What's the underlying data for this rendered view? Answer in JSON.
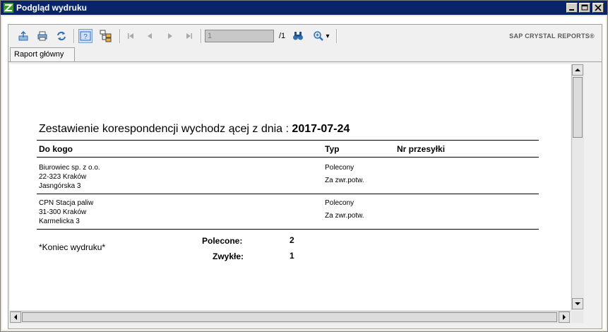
{
  "window": {
    "title": "Podgląd wydruku",
    "min_glyph": "0",
    "max_glyph": "1",
    "close_glyph": "r"
  },
  "toolbar": {
    "page_value": "1",
    "page_total": "/1",
    "brand": "SAP CRYSTAL REPORTS®",
    "zoom_caret": "▾"
  },
  "tabs": [
    {
      "label": "Raport główny"
    }
  ],
  "report": {
    "heading": "Zestawienie korespondencji wychodz ącej z dnia :",
    "date": "2017-07-24",
    "columns": {
      "to": "Do kogo",
      "type": "Typ",
      "tracking": "Nr przesyłki"
    },
    "rows": [
      {
        "address": [
          "Biurowiec sp. z o.o.",
          "22-323 Kraków",
          "Jasngórska 3"
        ],
        "type": [
          "Polecony",
          "Za zwr.potw."
        ],
        "tracking": ""
      },
      {
        "address": [
          "CPN Stacja paliw",
          "31-300 Kraków",
          "Karmelicka 3"
        ],
        "type": [
          "Polecony",
          "Za zwr.potw."
        ],
        "tracking": ""
      }
    ],
    "footer": {
      "end_label": "*Koniec wydruku*",
      "summary": [
        {
          "label": "Polecone:",
          "value": "2"
        },
        {
          "label": "Zwykłe:",
          "value": "1"
        }
      ]
    }
  },
  "colors": {
    "title_bar": "#0a246a",
    "viewer_bg": "#f0f0f0",
    "toolbar_icon": "#2f6fb8",
    "active_toggle": "#cfe0f6"
  }
}
